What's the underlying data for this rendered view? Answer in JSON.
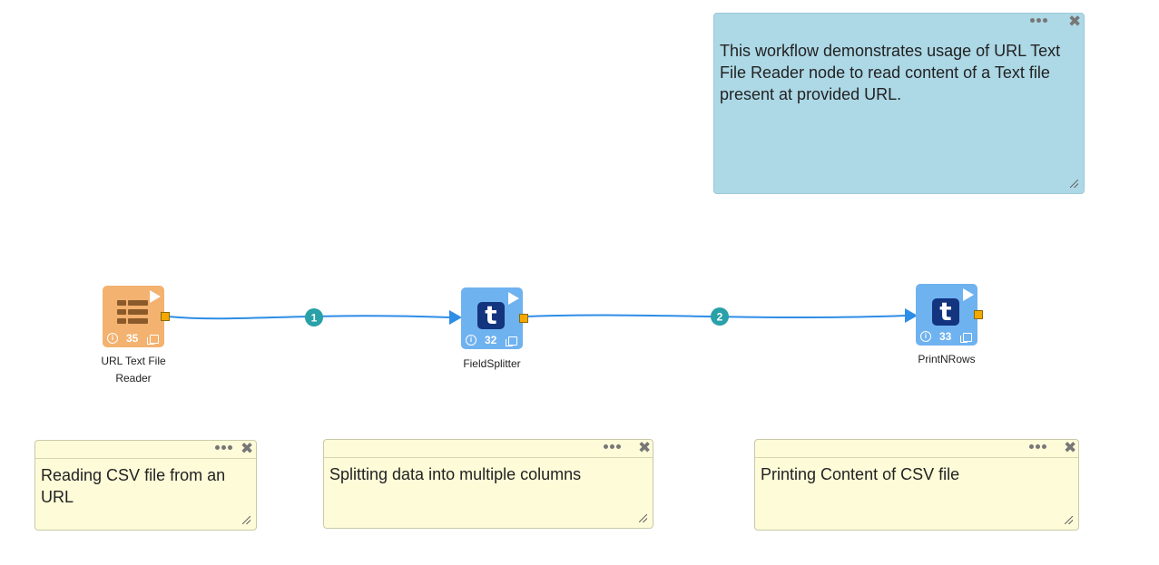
{
  "notes": {
    "description": {
      "text": "This workflow demonstrates usage of URL Text File Reader node to read content of a Text file present at provided URL."
    },
    "note1": {
      "text": "Reading CSV file from an URL"
    },
    "note2": {
      "text": "Splitting data into multiple columns"
    },
    "note3": {
      "text": "Printing Content of CSV file"
    },
    "close_glyph": "✖"
  },
  "nodes": [
    {
      "label": "URL Text File Reader",
      "count": "35",
      "icon": "table-icon",
      "color": "#f3b26f"
    },
    {
      "label": "FieldSplitter",
      "count": "32",
      "icon": "t-icon",
      "color": "#6fb2f0"
    },
    {
      "label": "PrintNRows",
      "count": "33",
      "icon": "t-icon",
      "color": "#6fb2f0"
    }
  ],
  "edges": [
    {
      "badge": "1"
    },
    {
      "badge": "2"
    }
  ],
  "icons": {
    "t_glyph": "t",
    "info_glyph": "i"
  },
  "colors": {
    "edge": "#2e8de6",
    "badge": "#2aa0a8",
    "note_yellow": "#fdfbd8",
    "note_blue": "#add8e6",
    "port": "#f5a800"
  }
}
